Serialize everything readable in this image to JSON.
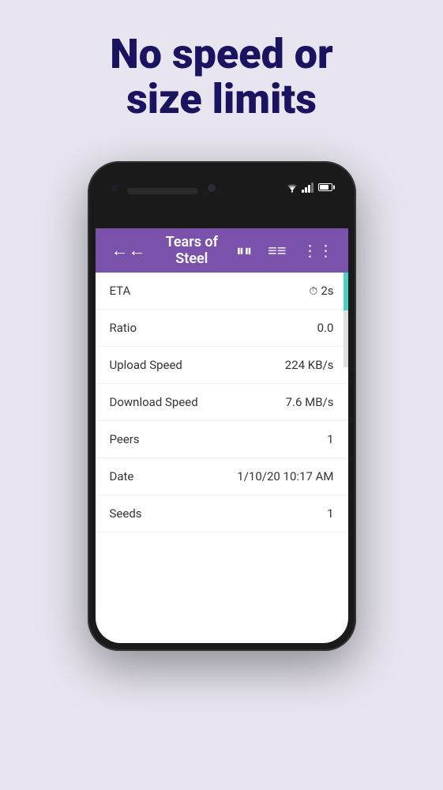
{
  "headline": {
    "line1": "No speed or",
    "line2": "size limits"
  },
  "phone": {
    "toolbar": {
      "title": "Tears of Steel",
      "back_label": "←",
      "pause_label": "⏸",
      "list_label": "≡",
      "more_label": "⋮"
    },
    "stats": [
      {
        "label": "ETA",
        "value": "2s",
        "has_clock": true
      },
      {
        "label": "Ratio",
        "value": "0.0",
        "has_clock": false
      },
      {
        "label": "Upload Speed",
        "value": "224 KB/s",
        "has_clock": false
      },
      {
        "label": "Download Speed",
        "value": "7.6 MB/s",
        "has_clock": false
      },
      {
        "label": "Peers",
        "value": "1",
        "has_clock": false
      },
      {
        "label": "Date",
        "value": "1/10/20 10:17 AM",
        "has_clock": false
      },
      {
        "label": "Seeds",
        "value": "1",
        "has_clock": false
      }
    ]
  },
  "colors": {
    "background": "#e8e5f0",
    "headline": "#1a1460",
    "toolbar_bg": "#7b52ab",
    "progress_bar": "#4dd0c4"
  }
}
